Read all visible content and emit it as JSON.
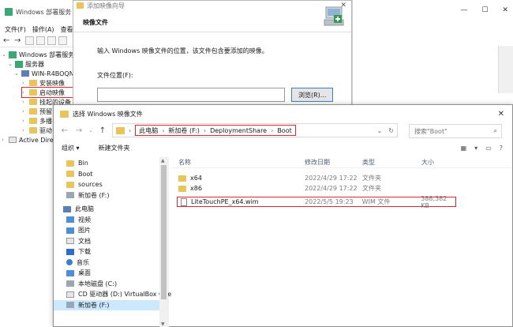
{
  "wds": {
    "title": "Windows 部署服务",
    "menu": [
      "文件(F)",
      "操作(A)",
      "查看"
    ],
    "tree": {
      "root": "Windows 部署服务",
      "servers": "服务器",
      "server_name": "WIN-R4BOQN",
      "install_images": "安装映像",
      "boot_images": "启动映像",
      "pending": "挂起的设备",
      "item_4": "预留",
      "item_5": "多播",
      "item_6": "驱动",
      "active_directory": "Active Dire"
    }
  },
  "wizard": {
    "title": "添加映像向导",
    "heading": "映像文件",
    "description": "输入 Windows 映像文件的位置，该文件包含要添加的映像。",
    "file_label": "文件位置(F):",
    "browse_button": "浏览(R)..."
  },
  "dialog": {
    "title": "选择 Windows 映像文件",
    "breadcrumb": [
      "此电脑",
      "新加卷 (F:)",
      "DeploymentShare",
      "Boot"
    ],
    "search_placeholder": "搜索\"Boot\"",
    "organize": "组织 ▾",
    "new_folder": "新建文件夹",
    "nav": {
      "folders": [
        "Bin",
        "Boot",
        "sources"
      ],
      "new_volume": "新加卷 (F:)",
      "this_pc": "此电脑",
      "pc_items": [
        "视频",
        "图片",
        "文档",
        "下载",
        "音乐",
        "桌面"
      ],
      "local_disk": "本地磁盘 (C:)",
      "cd_drive": "CD 驱动器 (D:) VirtualBox Gue",
      "new_volume_2": "新加卷 (F:)"
    },
    "columns": {
      "name": "名称",
      "date": "修改日期",
      "type": "类型",
      "size": "大小"
    },
    "files": [
      {
        "name": "x64",
        "date": "2022/4/29 17:22",
        "type": "文件夹",
        "size": ""
      },
      {
        "name": "x86",
        "date": "2022/4/29 17:22",
        "type": "文件夹",
        "size": ""
      },
      {
        "name": "LiteTouchPE_x64.wim",
        "date": "2022/5/5 19:23",
        "type": "WIM 文件",
        "size": "388,382 KB"
      }
    ]
  },
  "icons": {
    "app": "wds-icon",
    "folder": "folder-icon",
    "wim": "wim-file-icon"
  },
  "colors": {
    "highlight": "#e0262e",
    "selection": "#cce8ff",
    "folder": "#e8c45a"
  }
}
